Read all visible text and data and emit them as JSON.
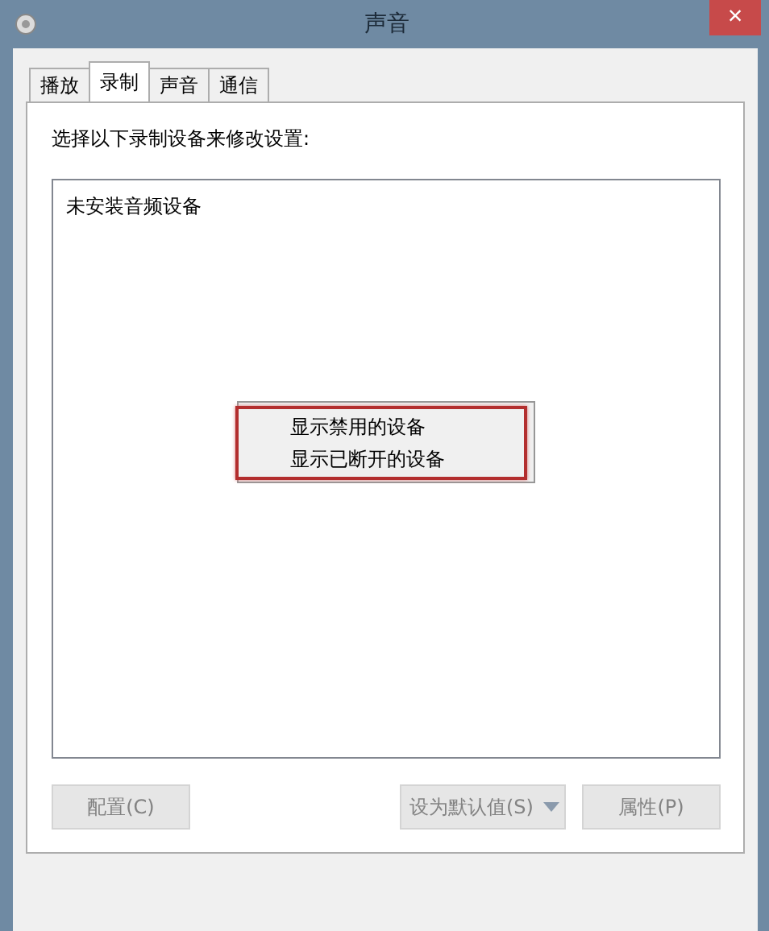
{
  "window": {
    "title": "声音",
    "close": "×"
  },
  "tabs": [
    {
      "label": "播放",
      "selected": false
    },
    {
      "label": "录制",
      "selected": true
    },
    {
      "label": "声音",
      "selected": false
    },
    {
      "label": "通信",
      "selected": false
    }
  ],
  "instruction": "选择以下录制设备来修改设置:",
  "device_list": {
    "empty_text": "未安装音频设备"
  },
  "context_menu": {
    "items": [
      "显示禁用的设备",
      "显示已断开的设备"
    ],
    "highlighted": true
  },
  "buttons": [
    {
      "label": "配置(C)",
      "disabled": true,
      "kind": "plain"
    },
    {
      "label": "设为默认值(S)",
      "disabled": true,
      "kind": "split"
    },
    {
      "label": "属性(P)",
      "disabled": true,
      "kind": "plain"
    }
  ]
}
